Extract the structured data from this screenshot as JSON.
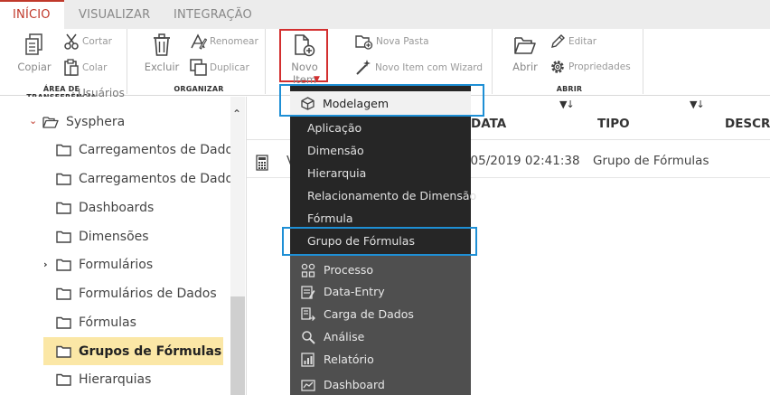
{
  "tabs": [
    {
      "label": "INÍCIO",
      "active": true
    },
    {
      "label": "VISUALIZAR",
      "active": false
    },
    {
      "label": "INTEGRAÇÃO",
      "active": false
    }
  ],
  "ribbon": {
    "groups": {
      "clipboard": "ÁREA DE TRANSFERÊNCIA",
      "organize": "ORGANIZAR",
      "open": "ABRIR"
    },
    "copy": "Copiar",
    "cut": "Cortar",
    "paste": "Colar",
    "delete": "Excluir",
    "rename": "Renomear",
    "duplicate": "Duplicar",
    "new_item": "Novo Item",
    "new_folder": "Nova Pasta",
    "new_item_wizard": "Novo Item com Wizard",
    "open": "Abrir",
    "edit": "Editar",
    "properties": "Propriedades"
  },
  "tree": {
    "partial_top": "Usuários",
    "root": "Sysphera",
    "items": [
      "Carregamentos de Dados n",
      "Carregamentos de Dados r",
      "Dashboards",
      "Dimensões",
      "Formulários",
      "Formulários de Dados",
      "Fórmulas",
      "Grupos de Fórmulas",
      "Hierarquias"
    ],
    "selected": "Grupos de Fórmulas"
  },
  "grid": {
    "columns": {
      "date": "DATA",
      "type": "TIPO",
      "description": "DESCRI"
    },
    "row": {
      "name": "V",
      "date": "/05/2019 02:41:38",
      "type": "Grupo de Fórmulas"
    }
  },
  "menu": {
    "modelagem": "Modelagem",
    "sub_items": [
      "Aplicação",
      "Dimensão",
      "Hierarquia",
      "Relacionamento de Dimensão",
      "Fórmula",
      "Grupo de Fórmulas"
    ],
    "other_items": [
      {
        "label": "Processo",
        "icon": "process-icon"
      },
      {
        "label": "Data-Entry",
        "icon": "data-entry-icon"
      },
      {
        "label": "Carga de Dados",
        "icon": "data-load-icon"
      },
      {
        "label": "Análise",
        "icon": "analysis-icon"
      },
      {
        "label": "Relatório",
        "icon": "report-icon"
      },
      {
        "label": "Dashboard",
        "icon": "dashboard-icon"
      }
    ]
  },
  "colors": {
    "accent": "#c0392b",
    "highlight_box": "#1e8fd5",
    "selected_tree_bg": "#fbe7a6",
    "menu_bg": "#262626",
    "menu_bg_lower": "#4f4f4f"
  }
}
